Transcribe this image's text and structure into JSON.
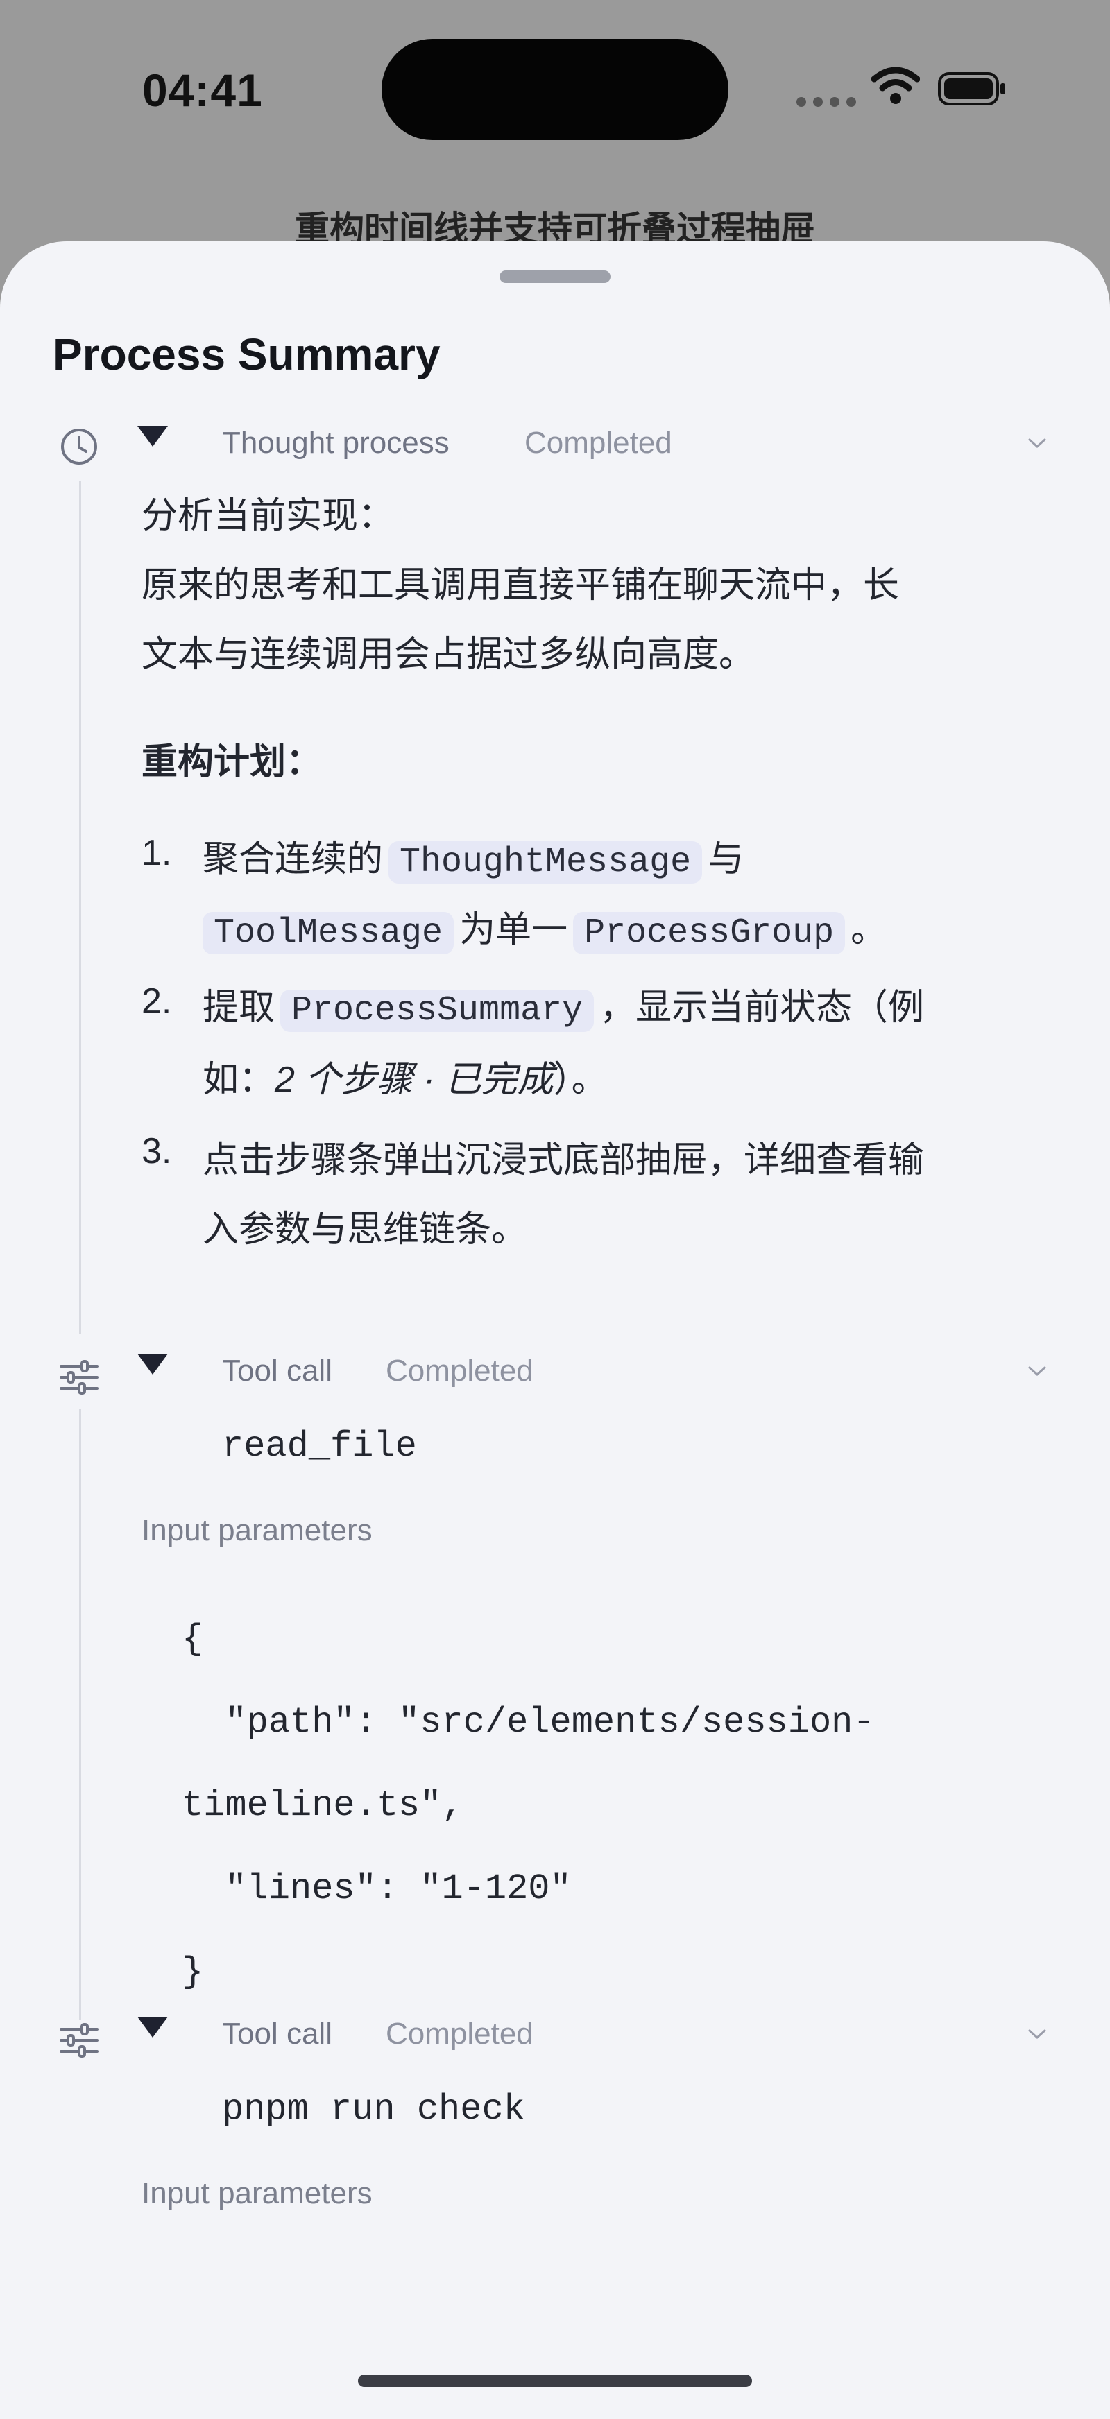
{
  "status_bar": {
    "time": "04:41"
  },
  "background_title": "重构时间线并支持可折叠过程抽屉",
  "sheet": {
    "title": "Process Summary",
    "sections": [
      {
        "label": "Thought process",
        "status": "Completed",
        "icon": "clock-icon"
      },
      {
        "label": "Tool call",
        "status": "Completed",
        "icon": "sliders-icon"
      },
      {
        "label": "Tool call",
        "status": "Completed",
        "icon": "sliders-icon"
      }
    ],
    "thought": {
      "intro_line1": "分析当前实现：",
      "intro_line2": "原来的思考和工具调用直接平铺在聊天流中，长",
      "intro_line3": "文本与连续调用会占据过多纵向高度。",
      "plan_title": "重构计划：",
      "items": [
        {
          "num": "1.",
          "a": "聚合连续的",
          "code1": "ThoughtMessage",
          "b": "与",
          "code2": "ToolMessage",
          "c": "为单一",
          "code3": "ProcessGroup",
          "d": "。"
        },
        {
          "num": "2.",
          "a": "提取",
          "code1": "ProcessSummary",
          "b": "，显示当前状态（例",
          "c": "如：",
          "em": "2 个步骤 · 已完成",
          "d": "）。"
        },
        {
          "num": "3.",
          "line1": "点击步骤条弹出沉浸式底部抽屉，详细查看输",
          "line2": "入参数与思维链条。"
        }
      ]
    },
    "tool1": {
      "name": "read_file",
      "params_label": "Input parameters",
      "code_lines": [
        "{",
        "  \"path\": \"src/elements/session-",
        "timeline.ts\",",
        "  \"lines\": \"1-120\"",
        "}"
      ]
    },
    "tool2": {
      "name": "pnpm run check",
      "params_label": "Input parameters"
    }
  }
}
